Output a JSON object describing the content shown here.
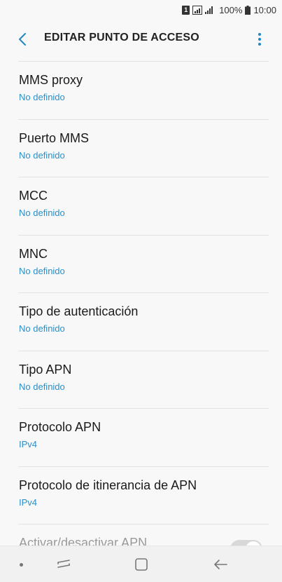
{
  "status_bar": {
    "sim_label": "1",
    "battery_text": "100%",
    "time": "10:00"
  },
  "app_bar": {
    "title": "EDITAR PUNTO DE ACCESO"
  },
  "items": [
    {
      "label": "MMS proxy",
      "value": "No definido"
    },
    {
      "label": "Puerto MMS",
      "value": "No definido"
    },
    {
      "label": "MCC",
      "value": "No definido"
    },
    {
      "label": "MNC",
      "value": "No definido"
    },
    {
      "label": "Tipo de autenticación",
      "value": "No definido"
    },
    {
      "label": "Tipo APN",
      "value": "No definido"
    },
    {
      "label": "Protocolo APN",
      "value": "IPv4"
    },
    {
      "label": "Protocolo de itinerancia de APN",
      "value": "IPv4"
    }
  ],
  "partial_item": {
    "label": "Activar/desactivar APN"
  },
  "colors": {
    "accent": "#2a8fc9",
    "background": "#f8f8f8"
  }
}
